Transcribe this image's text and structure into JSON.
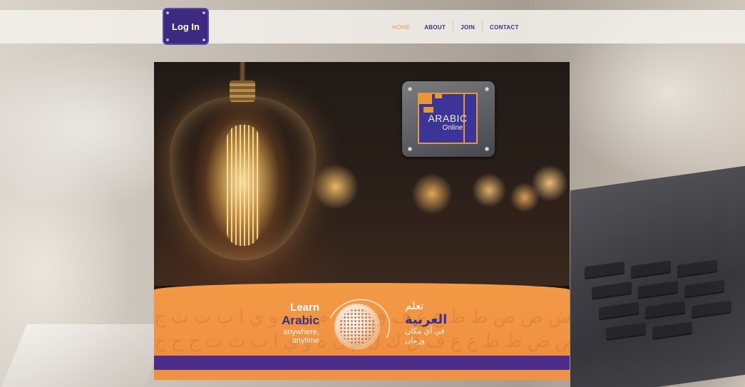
{
  "topbar": {
    "login_label": "Log In",
    "nav": [
      {
        "label": "HOME",
        "active": true
      },
      {
        "label": "ABOUT",
        "active": false
      },
      {
        "label": "JOIN",
        "active": false
      },
      {
        "label": "CONTACT",
        "active": false
      }
    ]
  },
  "hero": {
    "logo": {
      "line1": "ARABIC",
      "line2": "Online"
    },
    "banner": {
      "learn": "Learn",
      "arabic": "Arabic",
      "anywhere": "anywhere,",
      "anytime": "anytime",
      "ar_learn": "تعلم",
      "ar_arabic": "العربية",
      "ar_anywhere": "في أي مكان",
      "ar_anytime": "وزمان"
    }
  },
  "colors": {
    "nav_text": "#3c3179",
    "nav_active": "#e59a4a",
    "login_bg": "#3b2a7f",
    "banner_orange": "#f09242",
    "banner_stripe": "#4c2e8a"
  },
  "icons": {
    "globe": "globe-icon",
    "logo": "arabic-online-logo"
  }
}
